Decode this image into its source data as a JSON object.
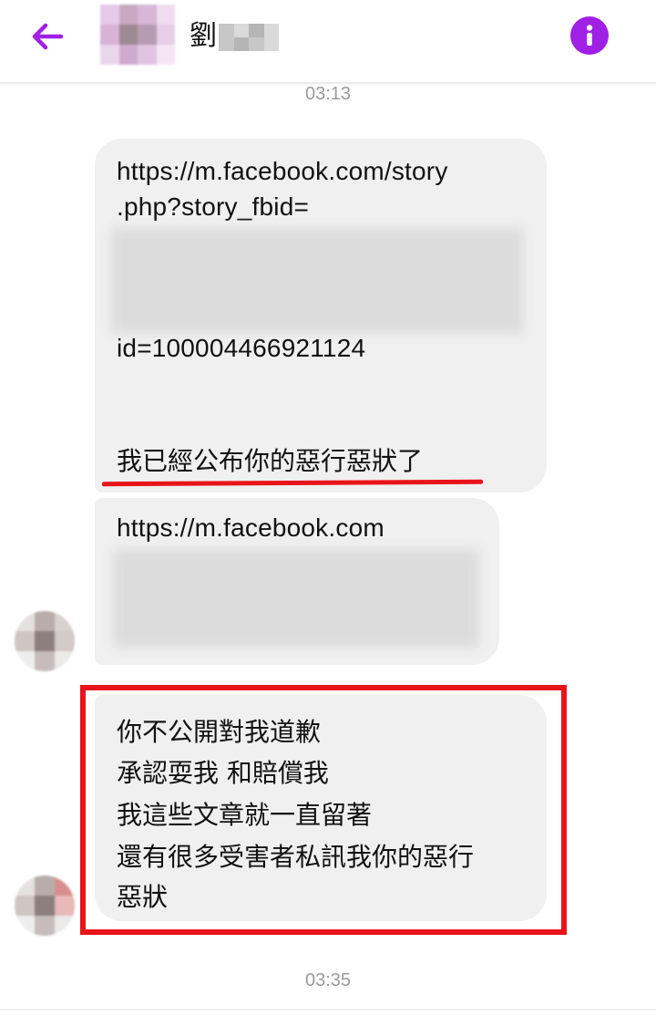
{
  "header": {
    "contact_name": "劉",
    "back_icon": "arrow-left-icon",
    "info_icon": "info-icon",
    "accent_color": "#a020e6"
  },
  "timestamps": [
    "03:13",
    "03:35"
  ],
  "messages": [
    {
      "lines": [
        "https://m.facebook.com/story",
        ".php?story_fbid=",
        "id=100004466921124",
        "我已經公布你的惡行惡狀了"
      ]
    },
    {
      "lines": [
        "https://m.facebook.com"
      ]
    },
    {
      "lines": [
        "你不公開對我道歉",
        "承認耍我 和賠償我",
        "我這些文章就一直留著",
        "還有很多受害者私訊我你的惡行",
        "惡狀"
      ]
    }
  ],
  "annotation_color": "#e8141a",
  "bubble_color": "#f0f0f0"
}
